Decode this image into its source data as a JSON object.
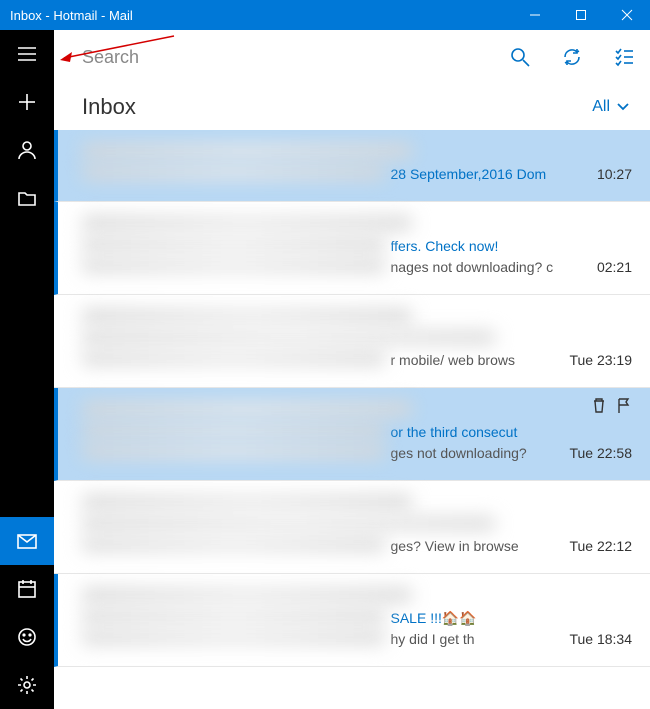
{
  "window": {
    "title": "Inbox - Hotmail - Mail"
  },
  "search": {
    "placeholder": "Search"
  },
  "header": {
    "folder": "Inbox",
    "filter_label": "All"
  },
  "messages": [
    {
      "unread": true,
      "selected": true,
      "subject_visible": "28 September,2016 Dom",
      "preview_visible": "",
      "time": "10:27",
      "show_actions": false
    },
    {
      "unread": true,
      "selected": false,
      "subject_visible": "ffers. Check now!",
      "preview_visible": "nages not downloading? c",
      "time": "02:21",
      "show_actions": false
    },
    {
      "unread": false,
      "selected": false,
      "subject_visible": "",
      "preview_visible": "r mobile/ web brows",
      "time": "Tue 23:19",
      "show_actions": false
    },
    {
      "unread": true,
      "selected": true,
      "subject_visible": "or the third consecut",
      "preview_visible": "ges not downloading?",
      "time": "Tue 22:58",
      "show_actions": true
    },
    {
      "unread": false,
      "selected": false,
      "subject_visible": "",
      "preview_visible": "ges? View in browse",
      "time": "Tue 22:12",
      "show_actions": false
    },
    {
      "unread": true,
      "selected": false,
      "subject_visible": "SALE !!!🏠🏠",
      "preview_visible": "hy did I get th",
      "time": "Tue 18:34",
      "show_actions": false
    }
  ]
}
